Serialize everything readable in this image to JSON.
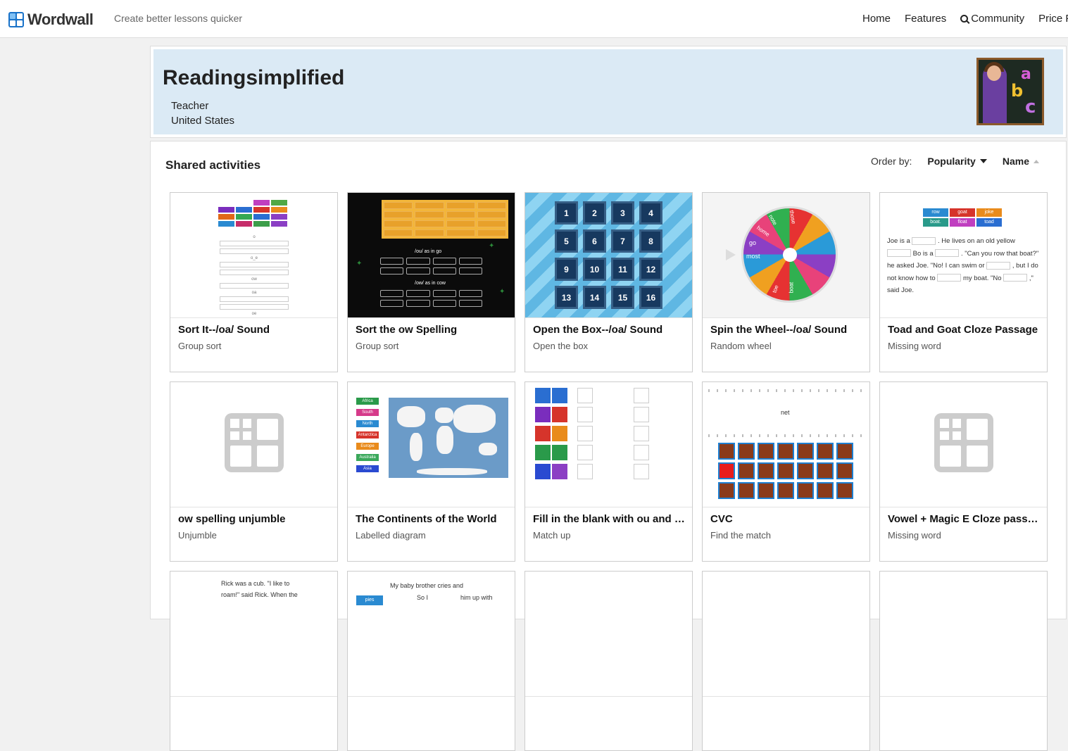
{
  "header": {
    "logo_text": "Wordwall",
    "tagline": "Create better lessons quicker",
    "nav": [
      {
        "label": "Home"
      },
      {
        "label": "Features"
      },
      {
        "label": "Community",
        "icon": "search-icon"
      },
      {
        "label": "Price P"
      }
    ]
  },
  "profile": {
    "name": "Readingsimplified",
    "role": "Teacher",
    "country": "United States",
    "avatar_letters": [
      "a",
      "b",
      "c"
    ]
  },
  "activities": {
    "heading": "Shared activities",
    "order_label": "Order by:",
    "order_options": [
      "Popularity",
      "Name"
    ],
    "cards": [
      {
        "title": "Sort It--/oa/ Sound",
        "type": "Group sort"
      },
      {
        "title": "Sort the ow Spelling",
        "type": "Group sort"
      },
      {
        "title": "Open the Box--/oa/ Sound",
        "type": "Open the box"
      },
      {
        "title": "Spin the Wheel--/oa/ Sound",
        "type": "Random wheel"
      },
      {
        "title": "Toad and Goat Cloze Passage",
        "type": "Missing word"
      },
      {
        "title": "ow spelling unjumble",
        "type": "Unjumble"
      },
      {
        "title": "The Continents of the World",
        "type": "Labelled diagram"
      },
      {
        "title": "Fill in the blank with ou and …",
        "type": "Match up"
      },
      {
        "title": "CVC",
        "type": "Find the match"
      },
      {
        "title": "Vowel + Magic E Cloze pass…",
        "type": "Missing word"
      }
    ]
  },
  "thumbs": {
    "sort_ow_captions": [
      "/ou/ as in go",
      "/ow/ as in cow"
    ],
    "box_numbers": [
      "1",
      "2",
      "3",
      "4",
      "5",
      "6",
      "7",
      "8",
      "9",
      "10",
      "11",
      "12",
      "13",
      "14",
      "15",
      "16"
    ],
    "wheel_words": [
      "those",
      "note",
      "home",
      "go",
      "most",
      "toe",
      "boat"
    ],
    "toad_wordbank": [
      "row",
      "goat",
      "joke",
      "boat.",
      "float",
      "toad"
    ],
    "toad_text": [
      "Joe is a",
      ". He lives on an old yellow",
      "Bo is a",
      ". \"Can you row that boat?\" he asked Joe. \"No! I can swim or",
      ", but I do not know how to",
      "my boat. \"No",
      ",\" said Joe."
    ],
    "continents": [
      "Africa",
      "South America",
      "North America",
      "Antarctica",
      "Europe",
      "Australia",
      "Asia"
    ],
    "cvc_word": "net",
    "row3_snippets": [
      "Rick was a cub. \"I like to",
      "roam!\" said Rick. When the",
      "My baby brother cries and",
      "So I",
      "him up with",
      "pies"
    ]
  },
  "colors": {
    "profile_bg": "#dbeaf5",
    "logo_blue": "#1a73c9"
  }
}
